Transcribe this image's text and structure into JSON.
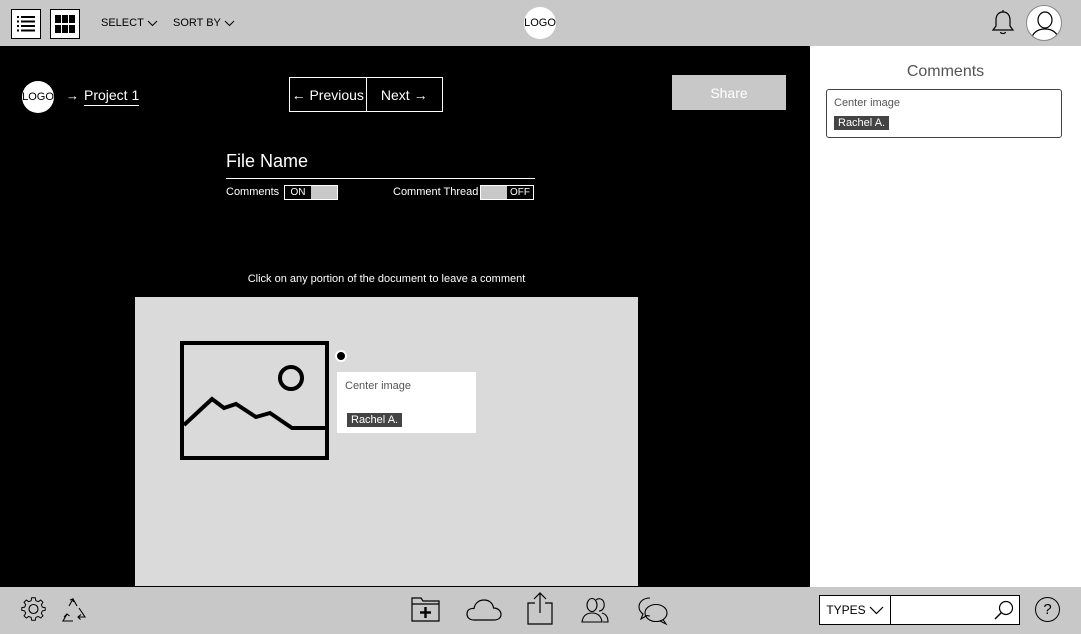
{
  "topbar": {
    "select_label": "SELECT",
    "sort_label": "SORT BY",
    "logo_text": "LOGO"
  },
  "breadcrumb": {
    "logo_text": "LOGO",
    "arrow": "→",
    "project": "Project 1"
  },
  "pager": {
    "previous": "← Previous",
    "next": "Next →"
  },
  "share_label": "Share",
  "file": {
    "name": "File Name",
    "comments_label": "Comments",
    "comments_state": "ON",
    "thread_label": "Comment Thread",
    "thread_state": "OFF"
  },
  "hint": "Click on any portion of the document  to leave a comment",
  "doc_comment": {
    "text": "Center image",
    "author": "Rachel A."
  },
  "panel": {
    "title": "Comments",
    "comments": [
      {
        "text": "Center image",
        "author": "Rachel A."
      }
    ]
  },
  "bottombar": {
    "types_label": "TYPES",
    "search_placeholder": "",
    "help": "?"
  },
  "colors": {
    "bar_gray": "#c8c8c8",
    "canvas_gray": "#dadada",
    "tag_dark": "#444444"
  }
}
